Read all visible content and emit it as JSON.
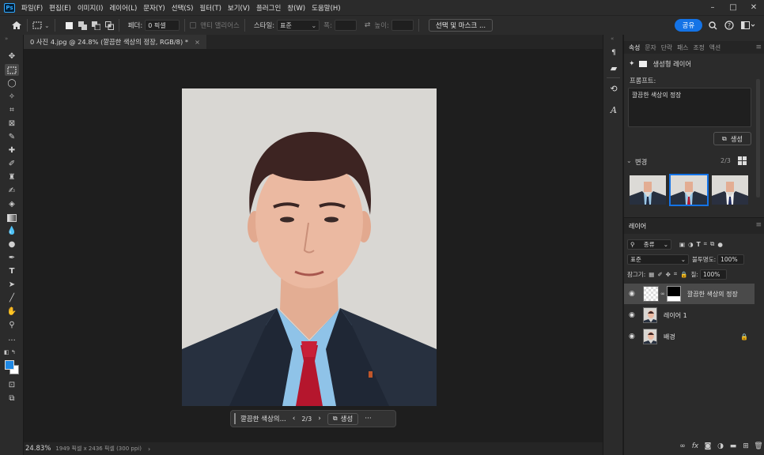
{
  "menubar": {
    "app_logo": "Ps",
    "items": [
      "파일(F)",
      "편집(E)",
      "이미지(I)",
      "레이어(L)",
      "문자(Y)",
      "선택(S)",
      "필터(T)",
      "보기(V)",
      "플러그인",
      "창(W)",
      "도움말(H)"
    ],
    "window_controls": [
      "–",
      "□",
      "✕"
    ]
  },
  "options": {
    "feather_label": "페더:",
    "feather_value": "0 픽셀",
    "antialias_label": "앤티 앨리어스",
    "style_label": "스타일:",
    "style_value": "표준",
    "width_label": "폭:",
    "height_label": "높이:",
    "select_mask_label": "선택 및 마스크 ...",
    "share_label": "공유"
  },
  "document": {
    "tab_title": "0 사진 4.jpg @ 24.8% (깔끔한 색상의 정장, RGB/8) *",
    "close": "×"
  },
  "taskbar": {
    "prompt_truncated": "깔끔한 색상의...",
    "counter": "2/3",
    "generate_label": "생성",
    "more": "···"
  },
  "status": {
    "zoom": "24.83%",
    "info": "1949 픽셀 x 2436 픽셀 (300 ppi)",
    "arrow": "›"
  },
  "properties": {
    "tabs": [
      "속성",
      "문자",
      "단락",
      "패스",
      "조정",
      "액션"
    ],
    "header_label": "생성형 레이어",
    "prompt_label": "프롬프트:",
    "prompt_text": "깔끔한 색상의 정장",
    "generate_label": "생성",
    "variations_label": "변경",
    "variations_count": "2/3"
  },
  "layers": {
    "title": "레이어",
    "filter_label": "종류",
    "blend_mode": "표준",
    "opacity_label": "불투명도:",
    "opacity_value": "100%",
    "lock_label": "잠그기:",
    "fill_label": "칠:",
    "fill_value": "100%",
    "items": [
      {
        "name": "깔끔한 색상의 정장",
        "selected": true
      },
      {
        "name": "레이어 1",
        "selected": false
      },
      {
        "name": "배경",
        "selected": false,
        "locked": true
      }
    ]
  },
  "colors": {
    "accent": "#1473e6",
    "foreground_swatch": "#1e88e5",
    "background_swatch": "#ffffff"
  }
}
